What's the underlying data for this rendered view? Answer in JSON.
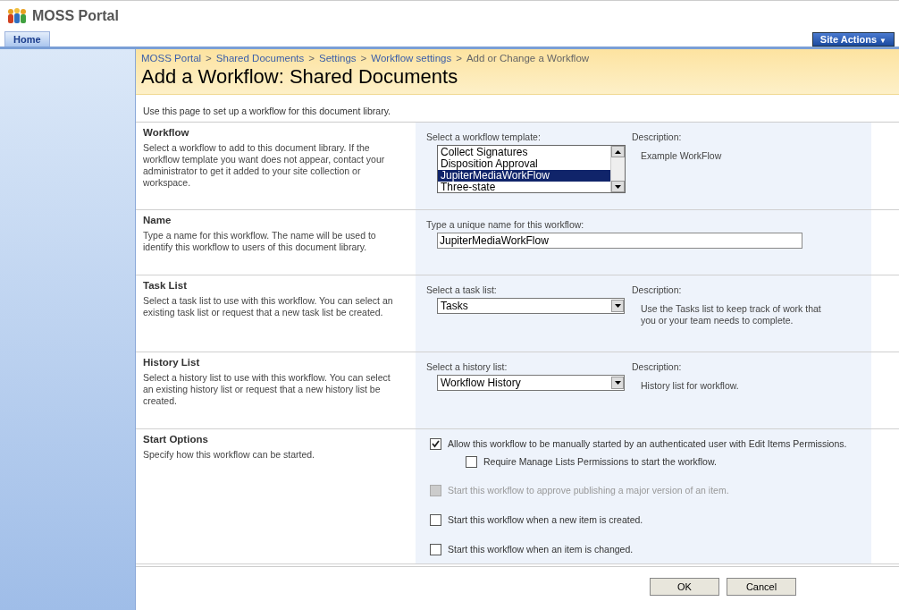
{
  "site": {
    "title": "MOSS Portal"
  },
  "tabs": [
    {
      "label": "Home",
      "selected": true
    }
  ],
  "site_actions": {
    "label": "Site Actions",
    "caret": "▼"
  },
  "breadcrumb": [
    {
      "label": "MOSS Portal",
      "link": true
    },
    {
      "label": "Shared Documents",
      "link": true
    },
    {
      "label": "Settings",
      "link": true
    },
    {
      "label": "Workflow settings",
      "link": true
    },
    {
      "label": "Add or Change a Workflow",
      "link": false
    }
  ],
  "breadcrumb_separator": ">",
  "page_title": "Add a Workflow: Shared Documents",
  "intro": "Use this page to set up a workflow for this document library.",
  "sections": [
    {
      "kind": "listbox",
      "heading": "Workflow",
      "description": "Select a workflow to add to this document library. If the workflow template you want does not appear, contact your administrator to get it added to your site collection or workspace.",
      "field_label": "Select a workflow template:",
      "options": [
        {
          "label": "Collect Signatures",
          "selected": false
        },
        {
          "label": "Disposition Approval",
          "selected": false
        },
        {
          "label": "JupiterMediaWorkFlow",
          "selected": true
        },
        {
          "label": "Three-state",
          "selected": false
        }
      ],
      "side_label": "Description:",
      "side_text": "Example WorkFlow"
    },
    {
      "kind": "textbox",
      "heading": "Name",
      "description": "Type a name for this workflow. The name will be used to identify this workflow to users of this document library.",
      "field_label": "Type a unique name for this workflow:",
      "value": "JupiterMediaWorkFlow"
    },
    {
      "kind": "dropdown",
      "heading": "Task List",
      "description": "Select a task list to use with this workflow. You can select an existing task list or request that a new task list be created.",
      "field_label": "Select a task list:",
      "value": "Tasks",
      "side_label": "Description:",
      "side_text": "Use the Tasks list to keep track of work that you or your team needs to complete."
    },
    {
      "kind": "dropdown",
      "heading": "History List",
      "description": "Select a history list to use with this workflow. You can select an existing history list or request that a new history list be created.",
      "field_label": "Select a history list:",
      "value": "Workflow History",
      "side_label": "Description:",
      "side_text": "History list for workflow."
    },
    {
      "kind": "options",
      "heading": "Start Options",
      "description": "Specify how this workflow can be started.",
      "checkboxes": [
        {
          "label": "Allow this workflow to be manually started by an authenticated user with Edit Items Permissions.",
          "checked": true,
          "disabled": false,
          "children": [
            {
              "label": "Require Manage Lists Permissions to start the workflow.",
              "checked": false,
              "disabled": false
            }
          ]
        },
        {
          "label": "Start this workflow to approve publishing a major version of an item.",
          "checked": false,
          "disabled": true
        },
        {
          "label": "Start this workflow when a new item is created.",
          "checked": false,
          "disabled": false
        },
        {
          "label": "Start this workflow when an item is changed.",
          "checked": false,
          "disabled": false
        }
      ]
    }
  ],
  "buttons": [
    "OK",
    "Cancel"
  ]
}
